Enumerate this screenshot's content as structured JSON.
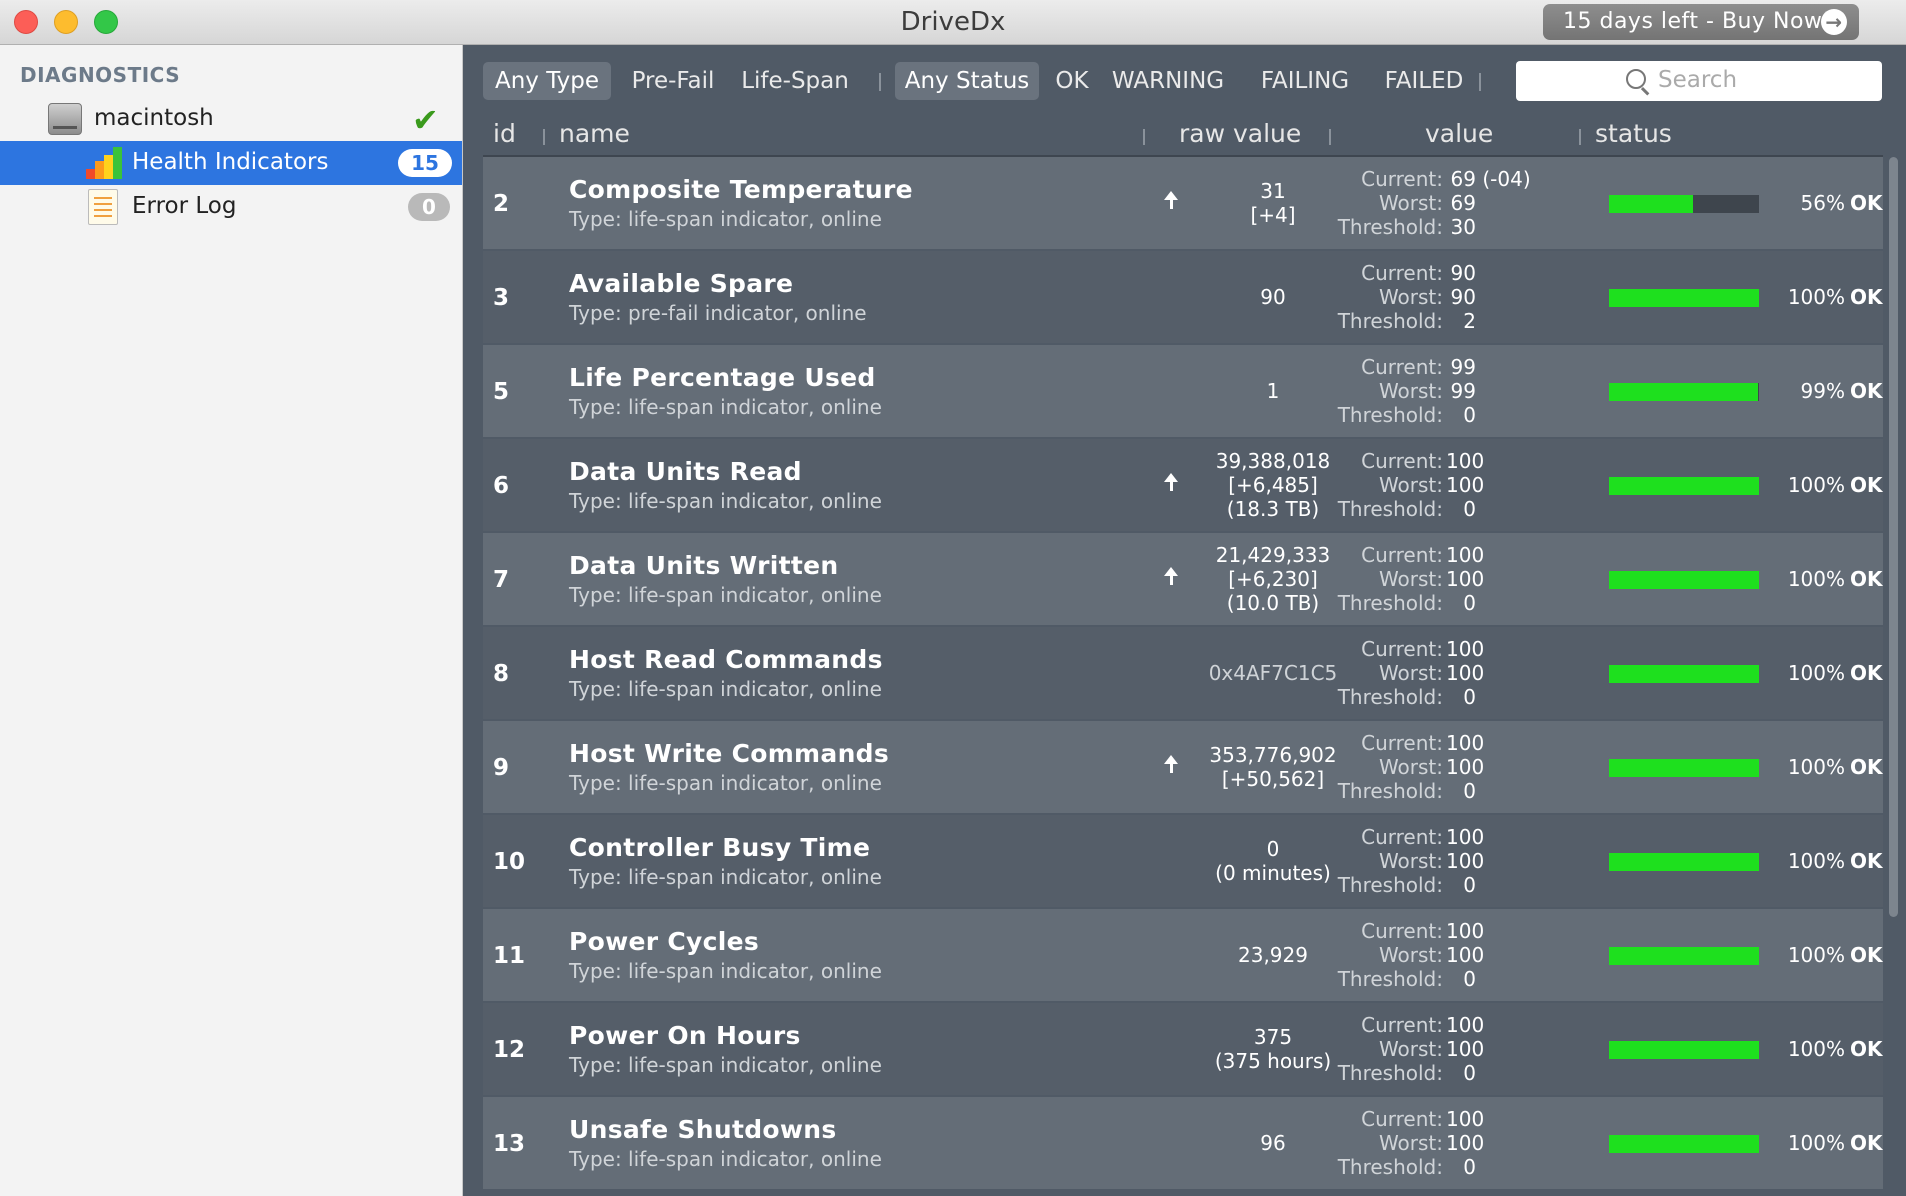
{
  "window": {
    "title": "DriveDx",
    "buy_label": "15 days left - Buy Now!"
  },
  "sidebar": {
    "heading": "DIAGNOSTICS",
    "disk": {
      "label": "macintosh",
      "status_icon": "checkmark-icon"
    },
    "items": [
      {
        "label": "Health Indicators",
        "badge": "15",
        "icon": "bar-chart-icon",
        "selected": true
      },
      {
        "label": "Error Log",
        "badge": "0",
        "icon": "log-icon",
        "selected": false
      }
    ]
  },
  "filters": {
    "type": [
      "Any Type",
      "Pre-Fail",
      "Life-Span"
    ],
    "status": [
      "Any Status",
      "OK",
      "WARNING",
      "FAILING",
      "FAILED"
    ],
    "active_type": "Any Type",
    "active_status": "Any Status"
  },
  "search": {
    "placeholder": "Search"
  },
  "columns": {
    "id": "id",
    "name": "name",
    "raw": "raw value",
    "value": "value",
    "status": "status"
  },
  "value_labels": {
    "current": "Current:",
    "worst": "Worst:",
    "threshold": "Threshold:"
  },
  "colors": {
    "bar_ok": "#1ee01e",
    "selection": "#2d75e0"
  },
  "rows": [
    {
      "id": "2",
      "name": "Composite Temperature",
      "type": "Type: life-span indicator, online",
      "raw": [
        "31",
        "[+4]"
      ],
      "trend": "up",
      "current": "69",
      "current_delta": "(-04)",
      "worst": "69",
      "threshold": "30",
      "health": 56,
      "pct": "56%",
      "status": "OK"
    },
    {
      "id": "3",
      "name": "Available Spare",
      "type": "Type: pre-fail indicator, online",
      "raw": [
        "90"
      ],
      "trend": "",
      "current": "90",
      "worst": "90",
      "threshold": "2",
      "health": 100,
      "pct": "100%",
      "status": "OK"
    },
    {
      "id": "5",
      "name": "Life Percentage Used",
      "type": "Type: life-span indicator, online",
      "raw": [
        "1"
      ],
      "trend": "",
      "current": "99",
      "worst": "99",
      "threshold": "0",
      "health": 99,
      "pct": "99%",
      "status": "OK"
    },
    {
      "id": "6",
      "name": "Data Units Read",
      "type": "Type: life-span indicator, online",
      "raw": [
        "39,388,018",
        "[+6,485]",
        "(18.3 TB)"
      ],
      "trend": "up",
      "current": "100",
      "worst": "100",
      "threshold": "0",
      "health": 100,
      "pct": "100%",
      "status": "OK"
    },
    {
      "id": "7",
      "name": "Data Units Written",
      "type": "Type: life-span indicator, online",
      "raw": [
        "21,429,333",
        "[+6,230]",
        "(10.0 TB)"
      ],
      "trend": "up",
      "current": "100",
      "worst": "100",
      "threshold": "0",
      "health": 100,
      "pct": "100%",
      "status": "OK"
    },
    {
      "id": "8",
      "name": "Host Read Commands",
      "type": "Type: life-span indicator, online",
      "raw": [
        "0x4AF7C1C5"
      ],
      "raw_muted": true,
      "trend": "",
      "current": "100",
      "worst": "100",
      "threshold": "0",
      "health": 100,
      "pct": "100%",
      "status": "OK"
    },
    {
      "id": "9",
      "name": "Host Write Commands",
      "type": "Type: life-span indicator, online",
      "raw": [
        "353,776,902",
        "[+50,562]"
      ],
      "trend": "up",
      "current": "100",
      "worst": "100",
      "threshold": "0",
      "health": 100,
      "pct": "100%",
      "status": "OK"
    },
    {
      "id": "10",
      "name": "Controller Busy Time",
      "type": "Type: life-span indicator, online",
      "raw": [
        "0",
        "(0 minutes)"
      ],
      "trend": "",
      "current": "100",
      "worst": "100",
      "threshold": "0",
      "health": 100,
      "pct": "100%",
      "status": "OK"
    },
    {
      "id": "11",
      "name": "Power Cycles",
      "type": "Type: life-span indicator, online",
      "raw": [
        "23,929"
      ],
      "trend": "",
      "current": "100",
      "worst": "100",
      "threshold": "0",
      "health": 100,
      "pct": "100%",
      "status": "OK"
    },
    {
      "id": "12",
      "name": "Power On Hours",
      "type": "Type: life-span indicator, online",
      "raw": [
        "375",
        "(375 hours)"
      ],
      "trend": "",
      "current": "100",
      "worst": "100",
      "threshold": "0",
      "health": 100,
      "pct": "100%",
      "status": "OK"
    },
    {
      "id": "13",
      "name": "Unsafe Shutdowns",
      "type": "Type: life-span indicator, online",
      "raw": [
        "96"
      ],
      "trend": "",
      "current": "100",
      "worst": "100",
      "threshold": "0",
      "health": 100,
      "pct": "100%",
      "status": "OK"
    }
  ]
}
